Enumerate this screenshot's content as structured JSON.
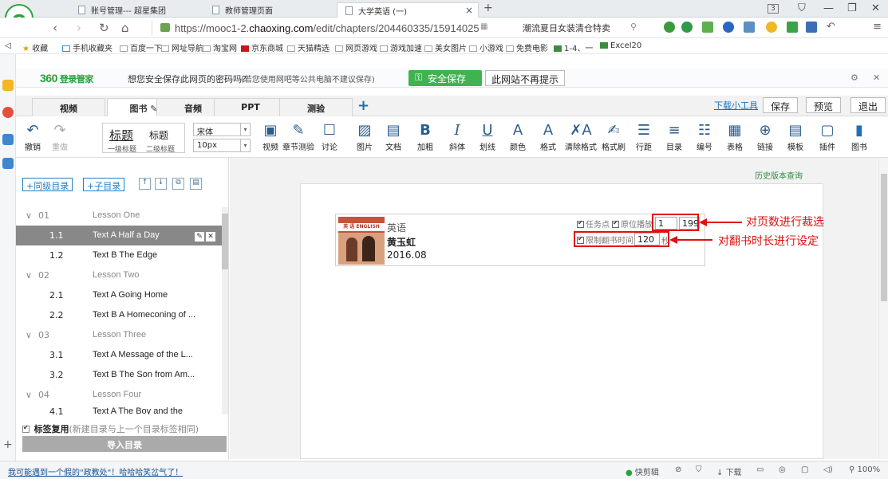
{
  "browser": {
    "tabs": [
      {
        "label": "账号管理--- 超星集团"
      },
      {
        "label": "教师管理页面"
      },
      {
        "label": "大学英语 (一)"
      }
    ],
    "url_prefix": "https://mooc1-2.",
    "url_domain": "chaoxing.com",
    "url_path": "/edit/chapters/204460335/15914025",
    "promo_text": "潮流夏日女装清仓特卖",
    "bookmarks": [
      "收藏",
      "手机收藏夹",
      "百度一下",
      "网址导航",
      "淘宝网",
      "京东商城",
      "天猫精选",
      "网页游戏",
      "游戏加速",
      "美女图片",
      "小游戏",
      "免费电影",
      "1-4、一",
      "Excel20"
    ]
  },
  "password_bar": {
    "logo": "360",
    "logo_sub": "登录管家",
    "question": "想您安全保存此网页的密码吗?",
    "note": "(若您使用网吧等公共电脑不建议保存)",
    "save_label": "安全保存",
    "no_hint_label": "此网站不再提示"
  },
  "editor_tabs": [
    {
      "label": "视频"
    },
    {
      "label": "图书 ✎"
    },
    {
      "label": "音频"
    },
    {
      "label": "PPT"
    },
    {
      "label": "测验"
    }
  ],
  "top_actions": {
    "download_tool": "下载小工具",
    "save": "保存",
    "preview": "预览",
    "exit": "退出"
  },
  "toolbar": {
    "undo": "撤销",
    "redo": "重做",
    "heading1": "标题",
    "heading2": "标题",
    "heading1_sub": "一级标题",
    "heading2_sub": "二级标题",
    "font": "宋体",
    "size": "10px",
    "tools": [
      "视频",
      "章节测验",
      "讨论",
      "图片",
      "文档",
      "加粗",
      "斜体",
      "划线",
      "颜色",
      "格式",
      "清除格式",
      "格式刷",
      "行距",
      "目录",
      "编号",
      "表格",
      "链接",
      "模板",
      "插件",
      "图书"
    ]
  },
  "sidebar": {
    "add_sibling": "+同级目录",
    "add_child": "+子目录",
    "rows": [
      {
        "num": "01",
        "title": "Lesson One",
        "group": true
      },
      {
        "num": "1.1",
        "title": "Text A Half a Day",
        "selected": true
      },
      {
        "num": "1.2",
        "title": "Text B The Edge"
      },
      {
        "num": "02",
        "title": "Lesson Two",
        "group": true
      },
      {
        "num": "2.1",
        "title": "Text A Going Home"
      },
      {
        "num": "2.2",
        "title": "Text B A Homeconing of ..."
      },
      {
        "num": "03",
        "title": "Lesson Three",
        "group": true
      },
      {
        "num": "3.1",
        "title": "Text A Message of the L..."
      },
      {
        "num": "3.2",
        "title": "Text B The Son from Am..."
      },
      {
        "num": "04",
        "title": "Lesson Four",
        "group": true
      },
      {
        "num": "4.1",
        "title": "Text A The Boy and the"
      }
    ],
    "tag_reuse_label": "标签复用",
    "tag_reuse_note": "(新建目录与上一个目录标签相同)",
    "import_label": "导入目录"
  },
  "book": {
    "history_link": "历史版本查询",
    "subject": "英语",
    "author": "黄玉虹",
    "date": "2016.08",
    "cover_text": "英 语 ENGLISH",
    "task_point": "任务点",
    "original_position": "原位播放",
    "page_from": "1",
    "page_to": "199",
    "limit_time": "限制翻书时间",
    "time_value": "120",
    "seconds": "秒",
    "annotation_pages": "对页数进行裁选",
    "annotation_time": "对翻书时长进行设定"
  },
  "status": {
    "news": "我可能遇到一个假的\"政教处\"！哈哈哈笑岔气了！",
    "kuaijian": "快剪辑",
    "download": "下载",
    "zoom": "100%"
  },
  "colors": {
    "accent_green": "#3fb34f",
    "annotation_red": "#e01010",
    "link_blue": "#1a6fc1"
  }
}
